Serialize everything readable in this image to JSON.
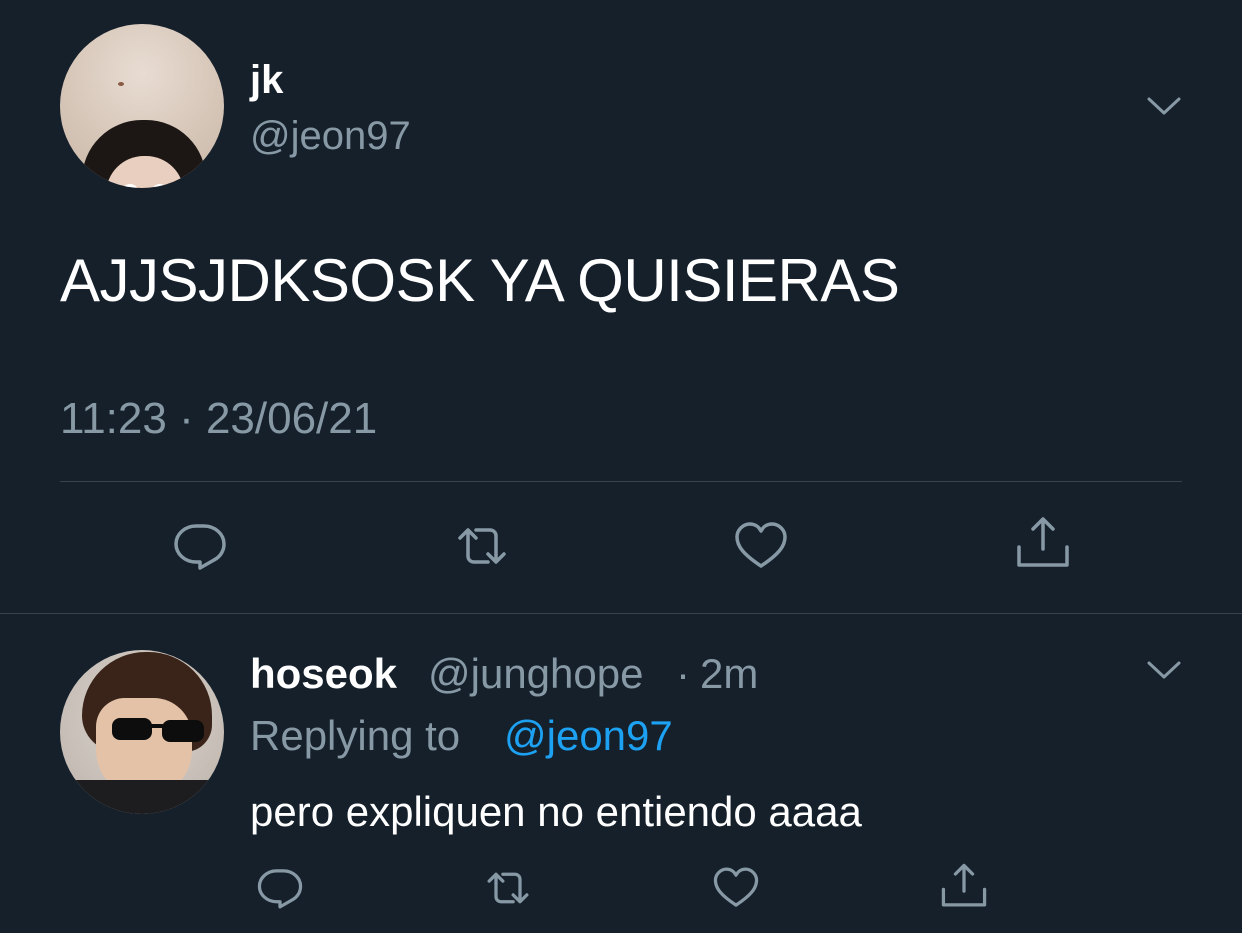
{
  "colors": {
    "background": "#15202b",
    "primary_text": "#ffffff",
    "secondary_text": "#8899a6",
    "link": "#1da1f2",
    "divider": "#38444d"
  },
  "main_tweet": {
    "display_name": "jk",
    "handle": "@jeon97",
    "text": "AJJSJDKSOSK YA QUISIERAS",
    "timestamp": "11:23 · 23/06/21",
    "menu_icon": "chevron-down-icon",
    "actions": [
      {
        "name": "reply",
        "icon": "comment-icon"
      },
      {
        "name": "retweet",
        "icon": "retweet-icon"
      },
      {
        "name": "like",
        "icon": "heart-icon"
      },
      {
        "name": "share",
        "icon": "share-icon"
      }
    ]
  },
  "reply_tweet": {
    "display_name": "hoseok",
    "handle": "@junghope",
    "separator": "·",
    "time_ago": "2m",
    "replying_to_label": "Replying to",
    "replying_to_handle": "@jeon97",
    "text": "pero expliquen no entiendo aaaa",
    "menu_icon": "chevron-down-icon",
    "actions": [
      {
        "name": "reply",
        "icon": "comment-icon"
      },
      {
        "name": "retweet",
        "icon": "retweet-icon"
      },
      {
        "name": "like",
        "icon": "heart-icon"
      },
      {
        "name": "share",
        "icon": "share-icon"
      }
    ]
  }
}
